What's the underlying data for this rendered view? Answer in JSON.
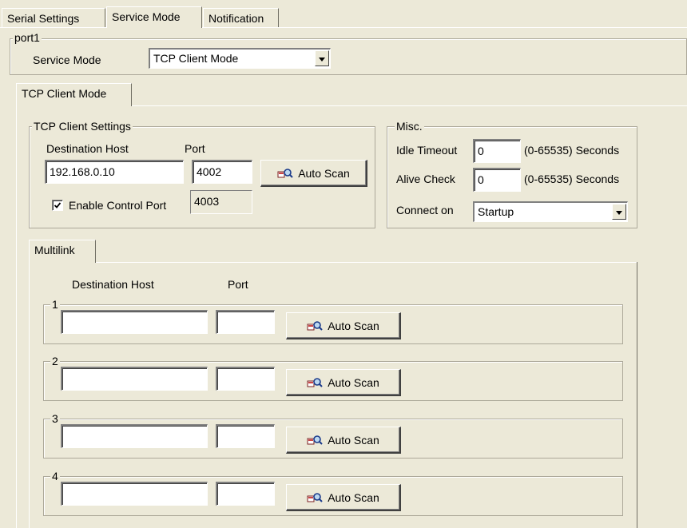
{
  "top_tabs": [
    {
      "label": "Serial Settings"
    },
    {
      "label": "Service Mode"
    },
    {
      "label": "Notification"
    }
  ],
  "port_group": {
    "title": "port1",
    "service_mode_label": "Service Mode",
    "service_mode_value": "TCP Client Mode"
  },
  "inner_tab": {
    "label": "TCP Client Mode"
  },
  "tcp_client_settings": {
    "title": "TCP Client Settings",
    "destination_host_label": "Destination Host",
    "port_label": "Port",
    "destination_host_value": "192.168.0.10",
    "port_value": "4002",
    "auto_scan_label": "Auto Scan",
    "enable_control_port_label": "Enable Control Port",
    "enable_control_port_checked": true,
    "control_port_value": "4003"
  },
  "misc": {
    "title": "Misc.",
    "idle_timeout_label": "Idle Timeout",
    "idle_timeout_value": "0",
    "idle_timeout_range": "(0-65535) Seconds",
    "alive_check_label": "Alive Check",
    "alive_check_value": "0",
    "alive_check_range": "(0-65535) Seconds",
    "connect_on_label": "Connect on",
    "connect_on_value": "Startup"
  },
  "multilink": {
    "tab_label": "Multilink",
    "destination_host_label": "Destination Host",
    "port_label": "Port",
    "rows": [
      {
        "number": "1",
        "host": "",
        "port": "",
        "auto_scan_label": "Auto Scan"
      },
      {
        "number": "2",
        "host": "",
        "port": "",
        "auto_scan_label": "Auto Scan"
      },
      {
        "number": "3",
        "host": "",
        "port": "",
        "auto_scan_label": "Auto Scan"
      },
      {
        "number": "4",
        "host": "",
        "port": "",
        "auto_scan_label": "Auto Scan"
      }
    ]
  },
  "icons": {
    "auto_scan": "magnifier-scan-icon",
    "dropdown": "chevron-down-icon",
    "checkbox": "checkmark-icon"
  }
}
